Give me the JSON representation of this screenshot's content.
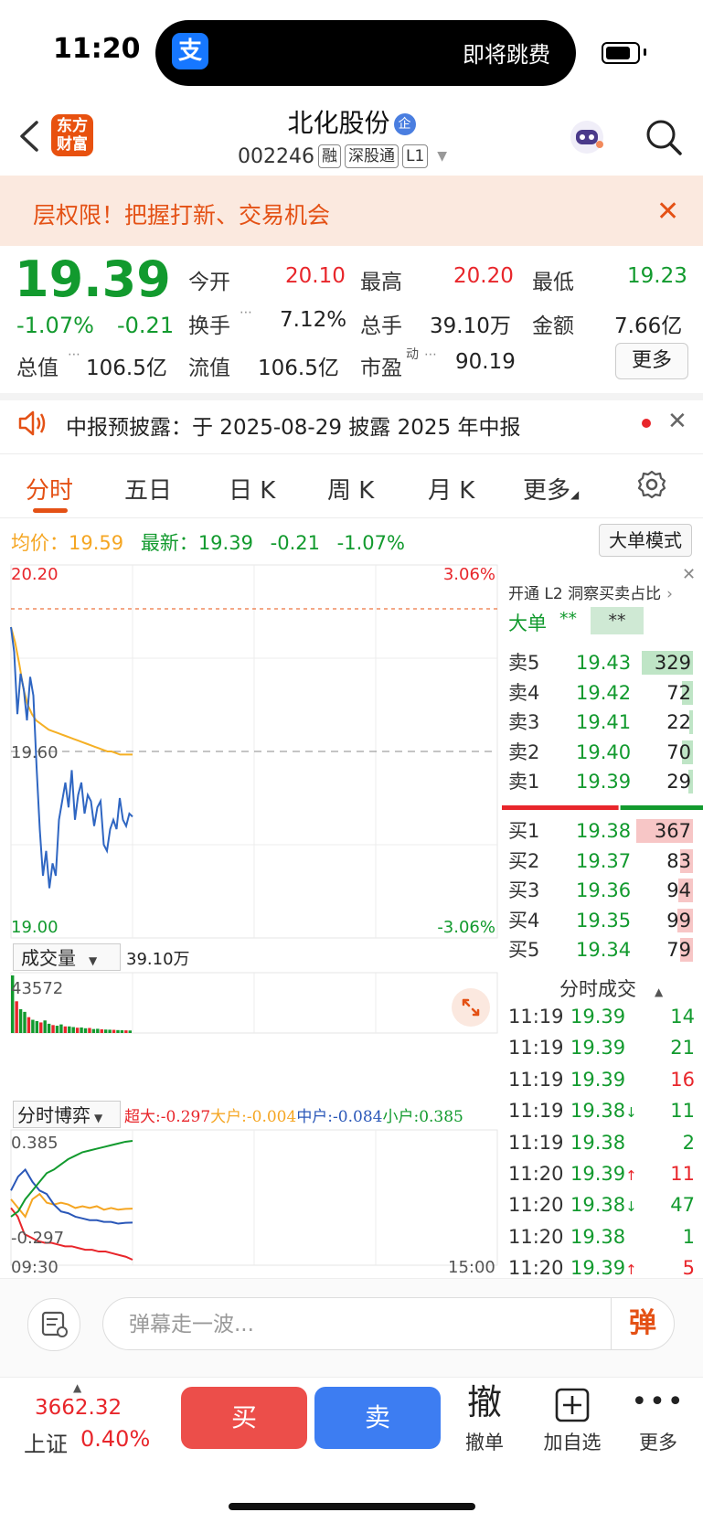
{
  "status_bar": {
    "time": "11:20",
    "island_text": "即将跳费",
    "alipay_glyph": "支"
  },
  "header": {
    "logo_line1": "东方",
    "logo_line2": "财富",
    "stock_name": "北化股份",
    "name_badge": "企",
    "code": "002246",
    "tags": [
      "融",
      "深股通",
      "L1"
    ]
  },
  "banner": {
    "text": "层权限！把握打新、交易机会"
  },
  "quote": {
    "price": "19.39",
    "pct": "-1.07%",
    "change": "-0.21",
    "open_label": "今开",
    "open": "20.10",
    "high_label": "最高",
    "high": "20.20",
    "low_label": "最低",
    "low": "19.23",
    "turnover_label": "换手",
    "turnover": "7.12%",
    "volume_label": "总手",
    "volume": "39.10万",
    "amount_label": "金额",
    "amount": "7.66亿",
    "mktcap_label": "总值",
    "mktcap": "106.5亿",
    "float_label": "流值",
    "float": "106.5亿",
    "pe_label": "市盈",
    "pe_sup": "动",
    "pe": "90.19",
    "more": "更多"
  },
  "notice": {
    "text": "中报预披露：于 2025-08-29 披露 2025 年中报"
  },
  "tabs": [
    "分时",
    "五日",
    "日 K",
    "周 K",
    "月 K",
    "更多"
  ],
  "avg_row": {
    "avg_label": "均价：",
    "avg": "19.59",
    "latest_label": "最新：",
    "latest": "19.39",
    "chg": "-0.21",
    "pct": "-1.07%",
    "mode_button": "大单模式"
  },
  "chart_data": [
    {
      "type": "line",
      "title": "",
      "x_start": "09:30",
      "x_end": "15:00",
      "ylim": [
        19.0,
        20.2
      ],
      "y_ticks": [
        "20.20",
        "19.60",
        "19.00"
      ],
      "right_ticks": [
        "3.06%",
        "-3.06%"
      ],
      "series": [
        {
          "name": "price",
          "values": [
            20.0,
            19.92,
            19.72,
            19.85,
            19.8,
            19.7,
            19.84,
            19.78,
            19.55,
            19.35,
            19.2,
            19.28,
            19.16,
            19.24,
            19.2,
            19.38,
            19.44,
            19.5,
            19.42,
            19.54,
            19.38,
            19.46,
            19.5,
            19.4,
            19.46,
            19.44,
            19.36,
            19.42,
            19.44,
            19.3,
            19.28,
            19.35,
            19.38,
            19.35,
            19.45,
            19.38,
            19.36,
            19.4,
            19.39
          ]
        },
        {
          "name": "avg",
          "values": [
            20.0,
            19.95,
            19.88,
            19.8,
            19.75,
            19.72,
            19.7,
            19.69,
            19.68,
            19.67,
            19.665,
            19.66,
            19.655,
            19.65,
            19.645,
            19.64,
            19.635,
            19.63,
            19.625,
            19.62,
            19.615,
            19.61,
            19.605,
            19.6,
            19.6,
            19.595,
            19.59,
            19.59,
            19.59,
            19.59
          ]
        }
      ]
    },
    {
      "type": "bar",
      "title": "",
      "volume_total": "39.10万",
      "ymax_label": "43572",
      "values": [
        43572,
        24000,
        18000,
        16000,
        12000,
        10000,
        9000,
        8000,
        9500,
        7000,
        6000,
        5500,
        6500,
        5000,
        5000,
        4500,
        4000,
        4200,
        3600,
        3800,
        3000,
        3200,
        2800,
        2600,
        2500,
        2400,
        2200,
        2100,
        2000,
        1900
      ]
    },
    {
      "type": "line",
      "title": "",
      "y_ticks": [
        "0.385",
        "-0.297"
      ],
      "series": [
        {
          "name": "超大",
          "color": "#e8262b",
          "values": [
            0.0,
            -0.05,
            -0.15,
            -0.17,
            -0.19,
            -0.2,
            -0.2,
            -0.21,
            -0.22,
            -0.22,
            -0.23,
            -0.24,
            -0.24,
            -0.25,
            -0.25,
            -0.26,
            -0.27,
            -0.28,
            -0.297
          ]
        },
        {
          "name": "大户",
          "color": "#f5a623",
          "values": [
            0.05,
            0.0,
            -0.05,
            0.05,
            0.08,
            0.03,
            0.02,
            0.03,
            0.02,
            0.0,
            0.01,
            0.0,
            0.01,
            -0.01,
            0.0,
            -0.01,
            -0.005,
            -0.004
          ]
        },
        {
          "name": "中户",
          "color": "#2a57b8",
          "values": [
            0.1,
            0.18,
            0.22,
            0.15,
            0.1,
            0.08,
            0.02,
            -0.02,
            -0.03,
            -0.05,
            -0.06,
            -0.07,
            -0.07,
            -0.08,
            -0.08,
            -0.09,
            -0.085,
            -0.084
          ]
        },
        {
          "name": "小户",
          "color": "#129a2e",
          "values": [
            -0.05,
            -0.02,
            0.05,
            0.1,
            0.15,
            0.2,
            0.22,
            0.25,
            0.28,
            0.3,
            0.32,
            0.33,
            0.34,
            0.35,
            0.36,
            0.37,
            0.38,
            0.385
          ]
        }
      ]
    }
  ],
  "volume_panel": {
    "selector": "成交量",
    "value": "39.10万",
    "max": "43572"
  },
  "flow_panel": {
    "selector": "分时博弈",
    "legend": [
      {
        "label": "超大:",
        "value": "-0.297",
        "color": "#e8262b"
      },
      {
        "label": "大户:",
        "value": "-0.004",
        "color": "#f5a623"
      },
      {
        "label": "中户:",
        "value": "-0.084",
        "color": "#2a57b8"
      },
      {
        "label": "小户:",
        "value": "0.385",
        "color": "#129a2e"
      }
    ],
    "max": "0.385",
    "min": "-0.297",
    "t_start": "09:30",
    "t_end": "15:00"
  },
  "order_book": {
    "l2_link": "开通 L2 洞察买卖占比",
    "big_order_label": "大单",
    "big_order_v1": "**",
    "big_order_v2": "**",
    "asks": [
      {
        "label": "卖5",
        "price": "19.43",
        "vol": "329",
        "ratio": 0.9
      },
      {
        "label": "卖4",
        "price": "19.42",
        "vol": "72",
        "ratio": 0.19
      },
      {
        "label": "卖3",
        "price": "19.41",
        "vol": "22",
        "ratio": 0.06
      },
      {
        "label": "卖2",
        "price": "19.40",
        "vol": "70",
        "ratio": 0.19
      },
      {
        "label": "卖1",
        "price": "19.39",
        "vol": "29",
        "ratio": 0.08
      }
    ],
    "bids": [
      {
        "label": "买1",
        "price": "19.38",
        "vol": "367",
        "ratio": 1.0
      },
      {
        "label": "买2",
        "price": "19.37",
        "vol": "83",
        "ratio": 0.23
      },
      {
        "label": "买3",
        "price": "19.36",
        "vol": "94",
        "ratio": 0.26
      },
      {
        "label": "买4",
        "price": "19.35",
        "vol": "99",
        "ratio": 0.27
      },
      {
        "label": "买5",
        "price": "19.34",
        "vol": "79",
        "ratio": 0.22
      }
    ],
    "buy_ratio": 0.58
  },
  "deals": {
    "title": "分时成交",
    "rows": [
      {
        "time": "11:19",
        "price": "19.39",
        "dir": "",
        "vol": "14",
        "color": "green",
        "vcolor": "green"
      },
      {
        "time": "11:19",
        "price": "19.39",
        "dir": "",
        "vol": "21",
        "color": "green",
        "vcolor": "green"
      },
      {
        "time": "11:19",
        "price": "19.39",
        "dir": "",
        "vol": "16",
        "color": "green",
        "vcolor": "red"
      },
      {
        "time": "11:19",
        "price": "19.38",
        "dir": "↓",
        "vol": "11",
        "color": "green",
        "vcolor": "green"
      },
      {
        "time": "11:19",
        "price": "19.38",
        "dir": "",
        "vol": "2",
        "color": "green",
        "vcolor": "green"
      },
      {
        "time": "11:20",
        "price": "19.39",
        "dir": "↑",
        "vol": "11",
        "color": "green",
        "vcolor": "red"
      },
      {
        "time": "11:20",
        "price": "19.38",
        "dir": "↓",
        "vol": "47",
        "color": "green",
        "vcolor": "green"
      },
      {
        "time": "11:20",
        "price": "19.38",
        "dir": "",
        "vol": "1",
        "color": "green",
        "vcolor": "green"
      },
      {
        "time": "11:20",
        "price": "19.39",
        "dir": "↑",
        "vol": "5",
        "color": "green",
        "vcolor": "red"
      }
    ]
  },
  "comment": {
    "placeholder": "弹幕走一波...",
    "danmu_glyph": "弹"
  },
  "bottom_bar": {
    "index_value": "3662.32",
    "index_name": "上证",
    "index_pct": "0.40%",
    "buy": "买",
    "sell": "卖",
    "cancel_glyph": "撤",
    "cancel_label": "撤单",
    "add_label": "加自选",
    "more_label": "更多"
  }
}
